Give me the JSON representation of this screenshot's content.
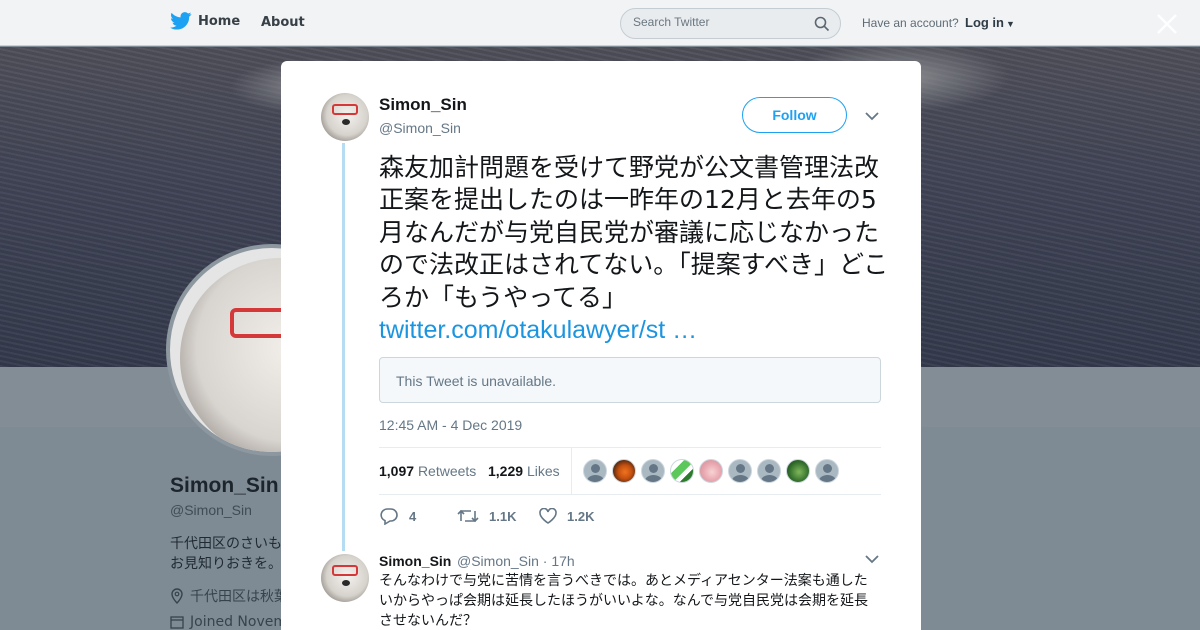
{
  "nav": {
    "home_label": "Home",
    "about_label": "About",
    "search_placeholder": "Search Twitter",
    "account_prompt": "Have an account?",
    "login_label": "Log in"
  },
  "profile": {
    "name": "Simon_Sin",
    "handle": "@Simon_Sin",
    "bio_line1": "千代田区のさいも",
    "bio_line2": "お見知りおきを。",
    "location": "千代田区は秋葉",
    "joined": "Joined Novem"
  },
  "tweet": {
    "author_name": "Simon_Sin",
    "author_handle": "@Simon_Sin",
    "follow_label": "Follow",
    "text": "森友加計問題を受けて野党が公文書管理法改正案を提出したのは一昨年の12月と去年の5月なんだが与党自民党が審議に応じなかったので法改正はされてない。「提案すべき」どころか「もうやってる」 ",
    "link_text": "twitter.com/otakulawyer/st …",
    "quoted_unavailable": "This Tweet is unavailable.",
    "timestamp": "12:45 AM - 4 Dec 2019",
    "retweets_count": "1,097",
    "retweets_label": "Retweets",
    "likes_count": "1,229",
    "likes_label": "Likes",
    "reply_count": "4",
    "retweet_action_count": "1.1K",
    "like_action_count": "1.2K"
  },
  "reply": {
    "author_name": "Simon_Sin",
    "author_handle": "@Simon_Sin · 17h",
    "text": "そんなわけで与党に苦情を言うべきでは。あとメディアセンター法案も通したいからやっぱ会期は延長したほうがいいよな。なんで与党自民党は会期を延長させないんだ？"
  },
  "colors": {
    "accent": "#1da1f2",
    "link": "#1b95e0",
    "thread_line": "#b5dcf3"
  }
}
